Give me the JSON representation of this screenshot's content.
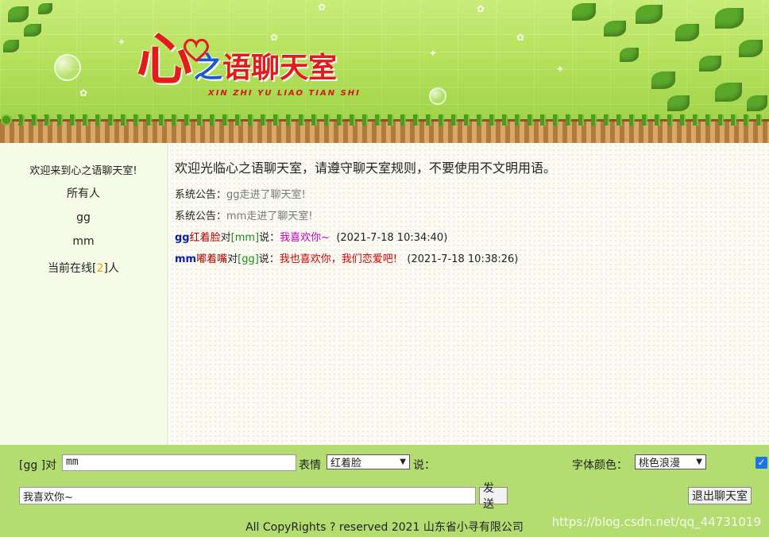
{
  "header": {
    "logo_char": "心",
    "logo_text_part1": "之",
    "logo_text_part2": "语聊天室",
    "logo_pinyin": "XIN ZHI YU LIAO TIAN SHI"
  },
  "sidebar": {
    "welcome": "欢迎来到心之语聊天室!",
    "users": [
      "所有人",
      "gg",
      "mm"
    ],
    "online_prefix": "当前在线[",
    "online_count": "2",
    "online_suffix": "]人"
  },
  "chat": {
    "intro": "欢迎光临心之语聊天室，请遵守聊天室规则，不要使用不文明用语。",
    "system_label": "系统公告：",
    "system_msgs": [
      "gg走进了聊天室!",
      "mm走进了聊天室!"
    ],
    "messages": [
      {
        "from": "gg",
        "expression": "红着脸",
        "dui": "对",
        "to": "[mm]",
        "shuo": "说：",
        "text": "我喜欢你~",
        "time": "(2021-7-18 10:34:40)"
      },
      {
        "from": "mm",
        "expression": "嘟着嘴",
        "dui": "对",
        "to": "[gg]",
        "shuo": "说：",
        "text": "我也喜欢你，我们恋爱吧!",
        "time": "(2021-7-18 10:38:26)"
      }
    ]
  },
  "controls": {
    "speaker_label": "[gg ]对",
    "target_value": "mm",
    "expression_label": "表情",
    "expression_value": "红着脸",
    "say_label": "说：",
    "font_color_label": "字体颜色：",
    "font_color_value": "桃色浪漫",
    "message_value": "我喜欢你~",
    "send_label": "发送",
    "exit_label": "退出聊天室"
  },
  "footer": {
    "copyright": "All CopyRights ? reserved 2021 山东省小寻有限公司",
    "watermark": "https://blog.csdn.net/qq_44731019"
  },
  "colors": {
    "banner_green": "#b6e25e",
    "control_bar": "#b3dc71",
    "logo_red": "#e21b1b",
    "logo_blue": "#1a56d8"
  }
}
